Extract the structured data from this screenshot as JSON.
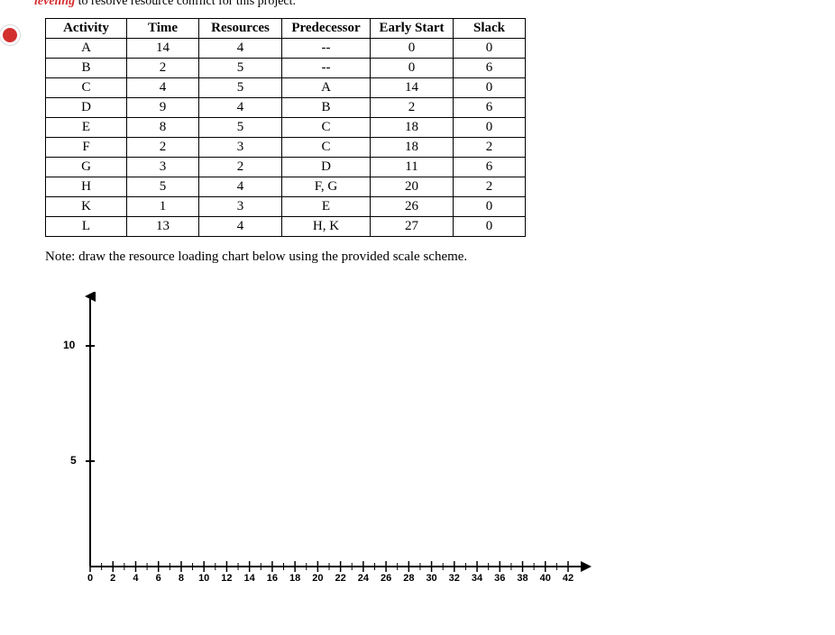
{
  "top_fragment": {
    "red_italic": "leveling",
    "black_rest": " to resolve resource conflict for this project."
  },
  "table": {
    "headers": [
      "Activity",
      "Time",
      "Resources",
      "Predecessor",
      "Early Start",
      "Slack"
    ],
    "rows": [
      [
        "A",
        "14",
        "4",
        "--",
        "0",
        "0"
      ],
      [
        "B",
        "2",
        "5",
        "--",
        "0",
        "6"
      ],
      [
        "C",
        "4",
        "5",
        "A",
        "14",
        "0"
      ],
      [
        "D",
        "9",
        "4",
        "B",
        "2",
        "6"
      ],
      [
        "E",
        "8",
        "5",
        "C",
        "18",
        "0"
      ],
      [
        "F",
        "2",
        "3",
        "C",
        "18",
        "2"
      ],
      [
        "G",
        "3",
        "2",
        "D",
        "11",
        "6"
      ],
      [
        "H",
        "5",
        "4",
        "F, G",
        "20",
        "2"
      ],
      [
        "K",
        "1",
        "3",
        "E",
        "26",
        "0"
      ],
      [
        "L",
        "13",
        "4",
        "H, K",
        "27",
        "0"
      ]
    ]
  },
  "note": "Note: draw the resource loading chart below using the provided scale scheme.",
  "chart_data": {
    "type": "line",
    "title": "",
    "xlabel": "",
    "ylabel": "",
    "x_ticks": [
      0,
      2,
      4,
      6,
      8,
      10,
      12,
      14,
      16,
      18,
      20,
      22,
      24,
      26,
      28,
      30,
      32,
      34,
      36,
      38,
      40,
      42
    ],
    "y_ticks": [
      5,
      10
    ],
    "xlim": [
      0,
      42
    ],
    "ylim": [
      0,
      10
    ],
    "series": []
  },
  "y_axis_labels": {
    "ten": "10",
    "five": "5"
  }
}
